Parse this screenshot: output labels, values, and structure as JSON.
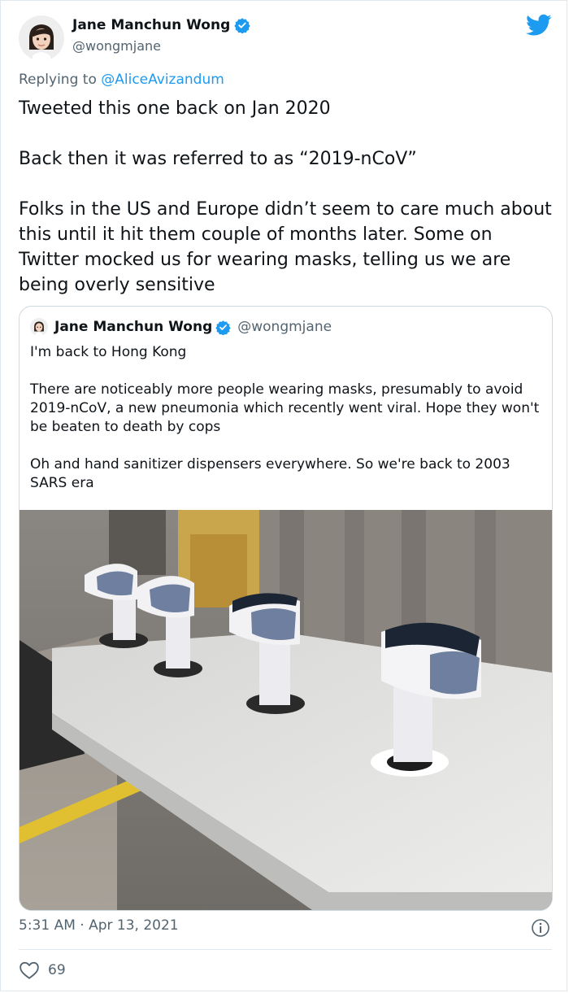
{
  "author": {
    "name": "Jane Manchun Wong",
    "handle": "@wongmjane",
    "avatar_icon": "memoji-avatar-icon",
    "verified_icon": "verified-badge-icon"
  },
  "reply": {
    "prefix": "Replying to ",
    "target": "@AliceAvizandum"
  },
  "tweet": {
    "paragraphs": [
      "Tweeted this one back on Jan 2020",
      "Back then it was referred to as “2019-nCoV”",
      "Folks in the US and Europe didn’t seem to care much about this until it hit them couple of months later. Some on Twitter mocked us for wearing masks, telling us we are being overly sensitive"
    ]
  },
  "quote": {
    "name": "Jane Manchun Wong",
    "handle": "@wongmjane",
    "paragraphs": [
      "I'm back to Hong Kong",
      "There are noticeably more people wearing masks, presumably to avoid 2019-nCoV, a new pneumonia which recently went viral. Hope they won't be beaten to death by cops",
      "Oh and hand sanitizer dispensers everywhere. So we're back to 2003 SARS era"
    ],
    "photo_icon": "hand-sanitizer-dispensers-photo"
  },
  "meta": {
    "timestamp": "5:31 AM · Apr 13, 2021",
    "likes": "69"
  },
  "colors": {
    "twitter_blue": "#1d9bf0",
    "secondary_text": "#536471",
    "primary_text": "#0f1419"
  }
}
